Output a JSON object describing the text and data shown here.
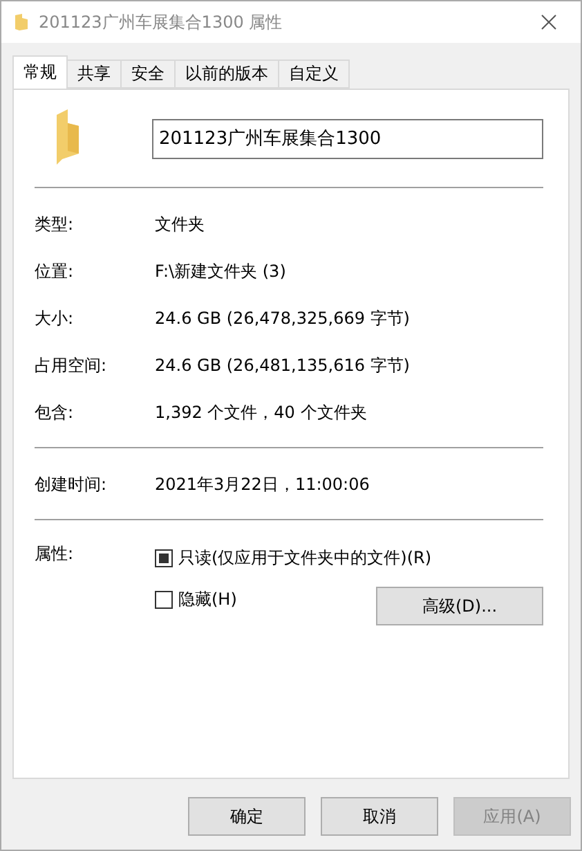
{
  "window": {
    "title": "201123广州车展集合1300 属性"
  },
  "tabs": [
    {
      "label": "常规",
      "selected": true
    },
    {
      "label": "共享",
      "selected": false
    },
    {
      "label": "安全",
      "selected": false
    },
    {
      "label": "以前的版本",
      "selected": false
    },
    {
      "label": "自定义",
      "selected": false
    }
  ],
  "name_field": {
    "value": "201123广州车展集合1300"
  },
  "info_groups": [
    [
      {
        "label": "类型:",
        "value": "文件夹"
      },
      {
        "label": "位置:",
        "value": "F:\\新建文件夹 (3)"
      },
      {
        "label": "大小:",
        "value": "24.6 GB (26,478,325,669 字节)"
      },
      {
        "label": "占用空间:",
        "value": "24.6 GB (26,481,135,616 字节)"
      },
      {
        "label": "包含:",
        "value": "1,392 个文件，40 个文件夹"
      }
    ],
    [
      {
        "label": "创建时间:",
        "value": "2021年3月22日，11:00:06"
      }
    ]
  ],
  "attributes": {
    "label": "属性:",
    "checkboxes": [
      {
        "label": "只读(仅应用于文件夹中的文件)(R)",
        "checked": false,
        "indeterminate": true
      },
      {
        "label": "隐藏(H)",
        "checked": false,
        "indeterminate": false
      }
    ],
    "advanced_button": "高级(D)..."
  },
  "buttons": [
    {
      "label": "确定",
      "disabled": false
    },
    {
      "label": "取消",
      "disabled": false
    },
    {
      "label": "应用(A)",
      "disabled": true
    }
  ]
}
